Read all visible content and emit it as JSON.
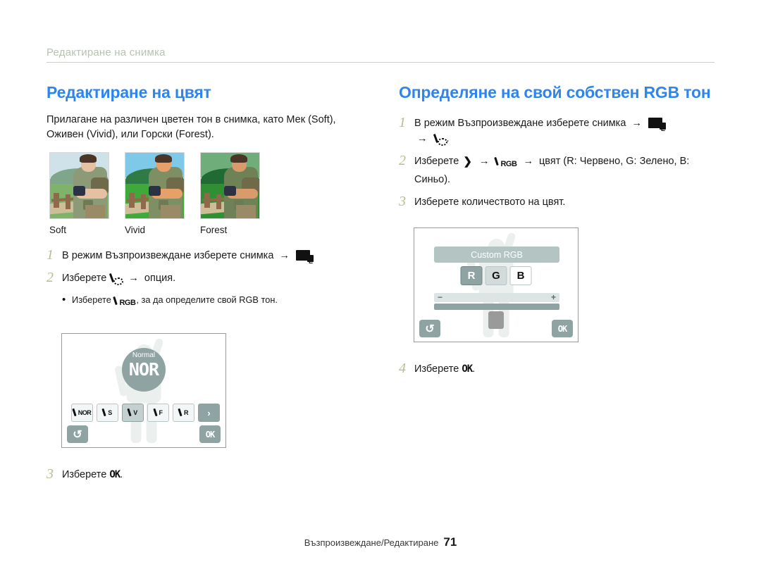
{
  "header": {
    "running_title": "Редактиране на снимка"
  },
  "left": {
    "section_title": "Редактиране на цвят",
    "lead": "Прилагане на различен цветен тон в снимка, като Мек (Soft), Оживен (Vivid), или Горски (Forest).",
    "thumbnails": [
      {
        "label": "Soft",
        "sky": "#cfe2ea",
        "hills": "#7fa58a",
        "grass": "#7fb36a",
        "vest": "#8d9a78",
        "skin": "#e6c0a2"
      },
      {
        "label": "Vivid",
        "sky": "#7ec8e8",
        "hills": "#2f7a45",
        "grass": "#3fa93a",
        "vest": "#7e8f63",
        "skin": "#e8a06a"
      },
      {
        "label": "Forest",
        "sky": "#6fae7a",
        "hills": "#1f6b33",
        "grass": "#2f8f33",
        "vest": "#6f8256",
        "skin": "#d99a6c"
      }
    ],
    "steps": [
      {
        "num": "1",
        "pre": "В режим Възпроизвеждане изберете снимка",
        "post": "."
      },
      {
        "num": "2",
        "pre": "Изберете",
        "mid": "опция",
        "post": "."
      }
    ],
    "substep": {
      "pre": "Изберете",
      "post": ", за да определите свой RGB тон."
    },
    "final_step": {
      "num": "3",
      "pre": "Изберете",
      "ok": "OK",
      "post": "."
    },
    "lcd": {
      "badge_caption": "Normal",
      "badge_value": "NOR",
      "filters": [
        {
          "label": "NOR",
          "selected": false
        },
        {
          "label": "S",
          "selected": false
        },
        {
          "label": "V",
          "selected": true
        },
        {
          "label": "F",
          "selected": false
        },
        {
          "label": "R",
          "selected": false
        }
      ],
      "next_label": "›",
      "back_label": "↺",
      "ok_label": "OK"
    }
  },
  "right": {
    "section_title": "Определяне на свой собствен RGB тон",
    "steps": [
      {
        "num": "1",
        "pre": "В режим Възпроизвеждане изберете снимка",
        "post": "."
      },
      {
        "num": "2",
        "pre": "Изберете",
        "mid": "цвят (R: Червено, G: Зелено, B: Синьо)",
        "post": "."
      },
      {
        "num": "3",
        "text": "Изберете количеството на цвят."
      }
    ],
    "final_step": {
      "num": "4",
      "pre": "Изберете",
      "ok": "OK",
      "post": "."
    },
    "lcd": {
      "title": "Custom RGB",
      "channels": [
        {
          "label": "R",
          "state": "active"
        },
        {
          "label": "G",
          "state": "half"
        },
        {
          "label": "B",
          "state": "normal"
        }
      ],
      "slider": {
        "minus": "−",
        "plus": "+"
      },
      "back_label": "↺",
      "ok_label": "OK"
    }
  },
  "footer": {
    "text": "Възпроизвеждане/Редактиране",
    "page": "71"
  },
  "colors": {
    "heading_blue": "#2d85f0",
    "step_number_green": "#b2c08f",
    "lcd_accent": "#8fa3a3",
    "rule": "#c9cfc6"
  }
}
